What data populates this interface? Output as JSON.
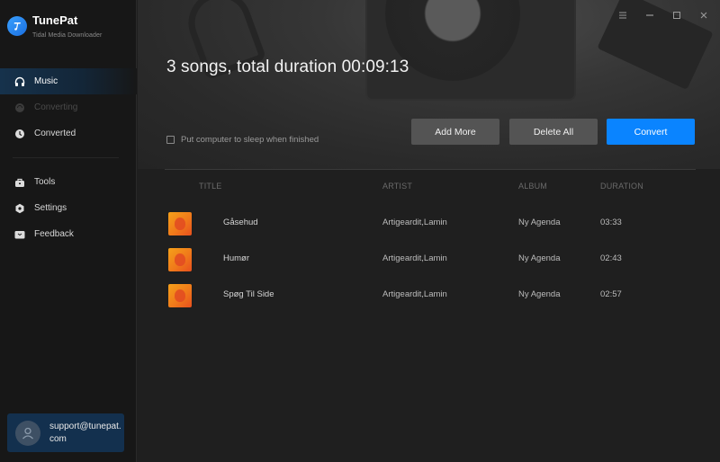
{
  "app": {
    "name": "TunePat",
    "subtitle": "Tidal Media Downloader"
  },
  "sidebar": {
    "items": [
      {
        "label": "Music",
        "icon": "headphones-icon",
        "state": "active"
      },
      {
        "label": "Converting",
        "icon": "converting-icon",
        "state": "disabled"
      },
      {
        "label": "Converted",
        "icon": "clock-icon",
        "state": "normal"
      },
      {
        "label": "Tools",
        "icon": "toolbox-icon",
        "state": "normal"
      },
      {
        "label": "Settings",
        "icon": "gear-icon",
        "state": "normal"
      },
      {
        "label": "Feedback",
        "icon": "mail-icon",
        "state": "normal"
      }
    ],
    "support_email": "support@tunepat.com"
  },
  "window_controls": [
    "menu-icon",
    "minimize-icon",
    "maximize-icon",
    "close-icon"
  ],
  "main": {
    "summary": "3 songs, total duration 00:09:13",
    "sleep_option": {
      "label": "Put computer to sleep when finished",
      "checked": false
    },
    "buttons": {
      "add_more": "Add More",
      "delete_all": "Delete All",
      "convert": "Convert"
    },
    "table": {
      "columns": [
        "TITLE",
        "ARTIST",
        "ALBUM",
        "DURATION"
      ],
      "rows": [
        {
          "title": "Gåsehud",
          "artist": "Artigeardit,Lamin",
          "album": "Ny Agenda",
          "duration": "03:33"
        },
        {
          "title": "Humør",
          "artist": "Artigeardit,Lamin",
          "album": "Ny Agenda",
          "duration": "02:43"
        },
        {
          "title": "Spøg Til Side",
          "artist": "Artigeardit,Lamin",
          "album": "Ny Agenda",
          "duration": "02:57"
        }
      ]
    }
  },
  "colors": {
    "accent": "#0a84ff",
    "sidebar_bg": "#171717",
    "main_bg": "#1f1f1f",
    "support_bg": "#13304e",
    "button_gray": "#545454"
  }
}
